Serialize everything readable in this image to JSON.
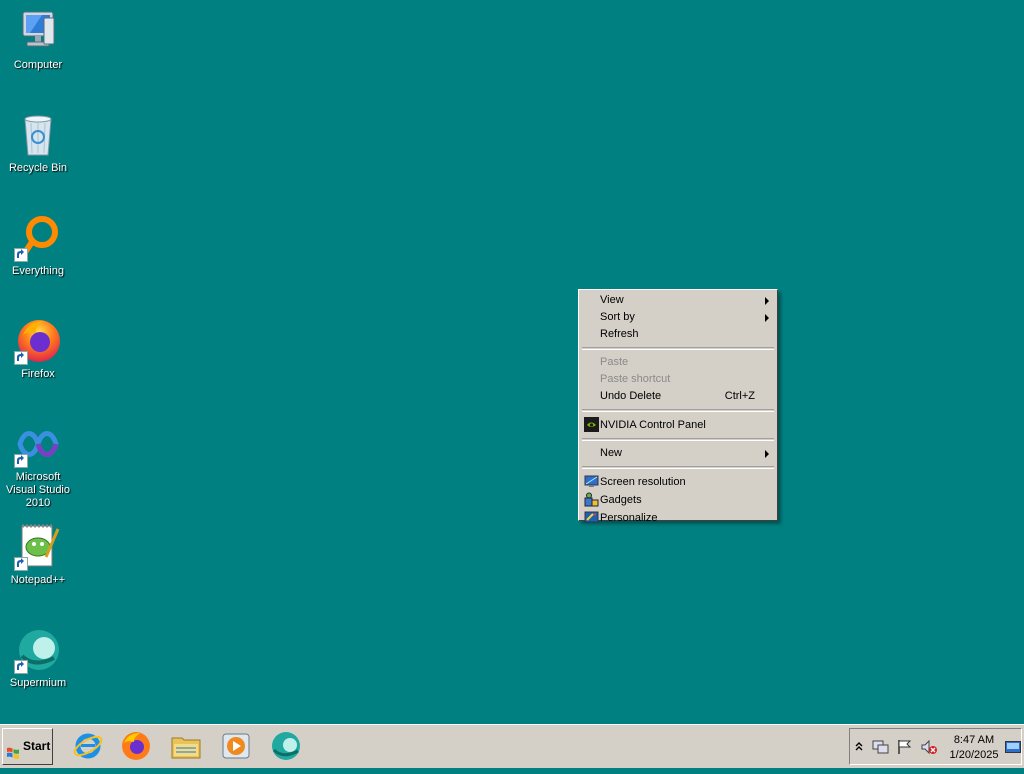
{
  "desktop": {
    "background_color": "#008080",
    "icons": [
      {
        "label": "Computer",
        "icon": "computer-icon"
      },
      {
        "label": "Recycle Bin",
        "icon": "recycle-bin-icon"
      },
      {
        "label": "Everything",
        "icon": "everything-icon"
      },
      {
        "label": "Firefox",
        "icon": "firefox-icon"
      },
      {
        "label": "Microsoft Visual Studio 2010",
        "icon": "visual-studio-icon"
      },
      {
        "label": "Notepad++",
        "icon": "notepad-plus-plus-icon"
      },
      {
        "label": "Supermium",
        "icon": "supermium-icon"
      }
    ]
  },
  "context_menu": {
    "items": [
      {
        "label": "View",
        "submenu": true
      },
      {
        "label": "Sort by",
        "submenu": true
      },
      {
        "label": "Refresh"
      },
      {
        "label": "Paste",
        "disabled": true
      },
      {
        "label": "Paste shortcut",
        "disabled": true
      },
      {
        "label": "Undo Delete",
        "shortcut": "Ctrl+Z"
      },
      {
        "label": "NVIDIA Control Panel",
        "icon": "nvidia-icon"
      },
      {
        "label": "New",
        "submenu": true
      },
      {
        "label": "Screen resolution",
        "icon": "screen-resolution-icon"
      },
      {
        "label": "Gadgets",
        "icon": "gadgets-icon"
      },
      {
        "label": "Personalize",
        "icon": "personalize-icon"
      }
    ]
  },
  "taskbar": {
    "start_label": "Start",
    "pinned": [
      "internet-explorer-icon",
      "firefox-icon",
      "file-explorer-icon",
      "media-player-icon",
      "supermium-icon"
    ],
    "tray_icons": [
      "show-hidden-icons-chevron",
      "network-icon",
      "action-center-flag-icon",
      "volume-muted-icon"
    ],
    "clock": {
      "time": "8:47 AM",
      "date": "1/20/2025"
    }
  }
}
